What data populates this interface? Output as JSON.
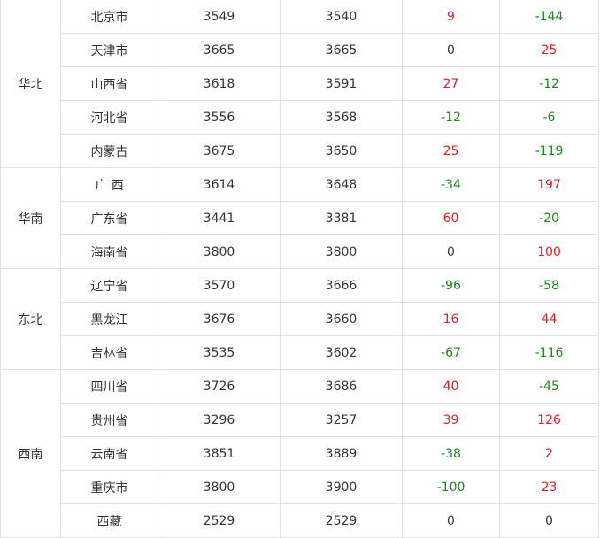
{
  "colors": {
    "increase": "#e02020",
    "decrease": "#1a8a1a",
    "neutral": "#333333",
    "grid": "#e0e0e0"
  },
  "groups": [
    {
      "region": "华北",
      "rows": [
        {
          "province": "北京市",
          "v1": "3549",
          "v2": "3540",
          "d1": "9",
          "d2": "-144"
        },
        {
          "province": "天津市",
          "v1": "3665",
          "v2": "3665",
          "d1": "0",
          "d2": "25"
        },
        {
          "province": "山西省",
          "v1": "3618",
          "v2": "3591",
          "d1": "27",
          "d2": "-12"
        },
        {
          "province": "河北省",
          "v1": "3556",
          "v2": "3568",
          "d1": "-12",
          "d2": "-6"
        },
        {
          "province": "内蒙古",
          "v1": "3675",
          "v2": "3650",
          "d1": "25",
          "d2": "-119"
        }
      ]
    },
    {
      "region": "华南",
      "rows": [
        {
          "province": "广 西",
          "v1": "3614",
          "v2": "3648",
          "d1": "-34",
          "d2": "197"
        },
        {
          "province": "广东省",
          "v1": "3441",
          "v2": "3381",
          "d1": "60",
          "d2": "-20"
        },
        {
          "province": "海南省",
          "v1": "3800",
          "v2": "3800",
          "d1": "0",
          "d2": "100"
        }
      ]
    },
    {
      "region": "东北",
      "rows": [
        {
          "province": "辽宁省",
          "v1": "3570",
          "v2": "3666",
          "d1": "-96",
          "d2": "-58"
        },
        {
          "province": "黑龙江",
          "v1": "3676",
          "v2": "3660",
          "d1": "16",
          "d2": "44"
        },
        {
          "province": "吉林省",
          "v1": "3535",
          "v2": "3602",
          "d1": "-67",
          "d2": "-116"
        }
      ]
    },
    {
      "region": "西南",
      "rows": [
        {
          "province": "四川省",
          "v1": "3726",
          "v2": "3686",
          "d1": "40",
          "d2": "-45"
        },
        {
          "province": "贵州省",
          "v1": "3296",
          "v2": "3257",
          "d1": "39",
          "d2": "126"
        },
        {
          "province": "云南省",
          "v1": "3851",
          "v2": "3889",
          "d1": "-38",
          "d2": "2"
        },
        {
          "province": "重庆市",
          "v1": "3800",
          "v2": "3900",
          "d1": "-100",
          "d2": "23"
        },
        {
          "province": "西藏",
          "v1": "2529",
          "v2": "2529",
          "d1": "0",
          "d2": "0"
        }
      ]
    }
  ]
}
